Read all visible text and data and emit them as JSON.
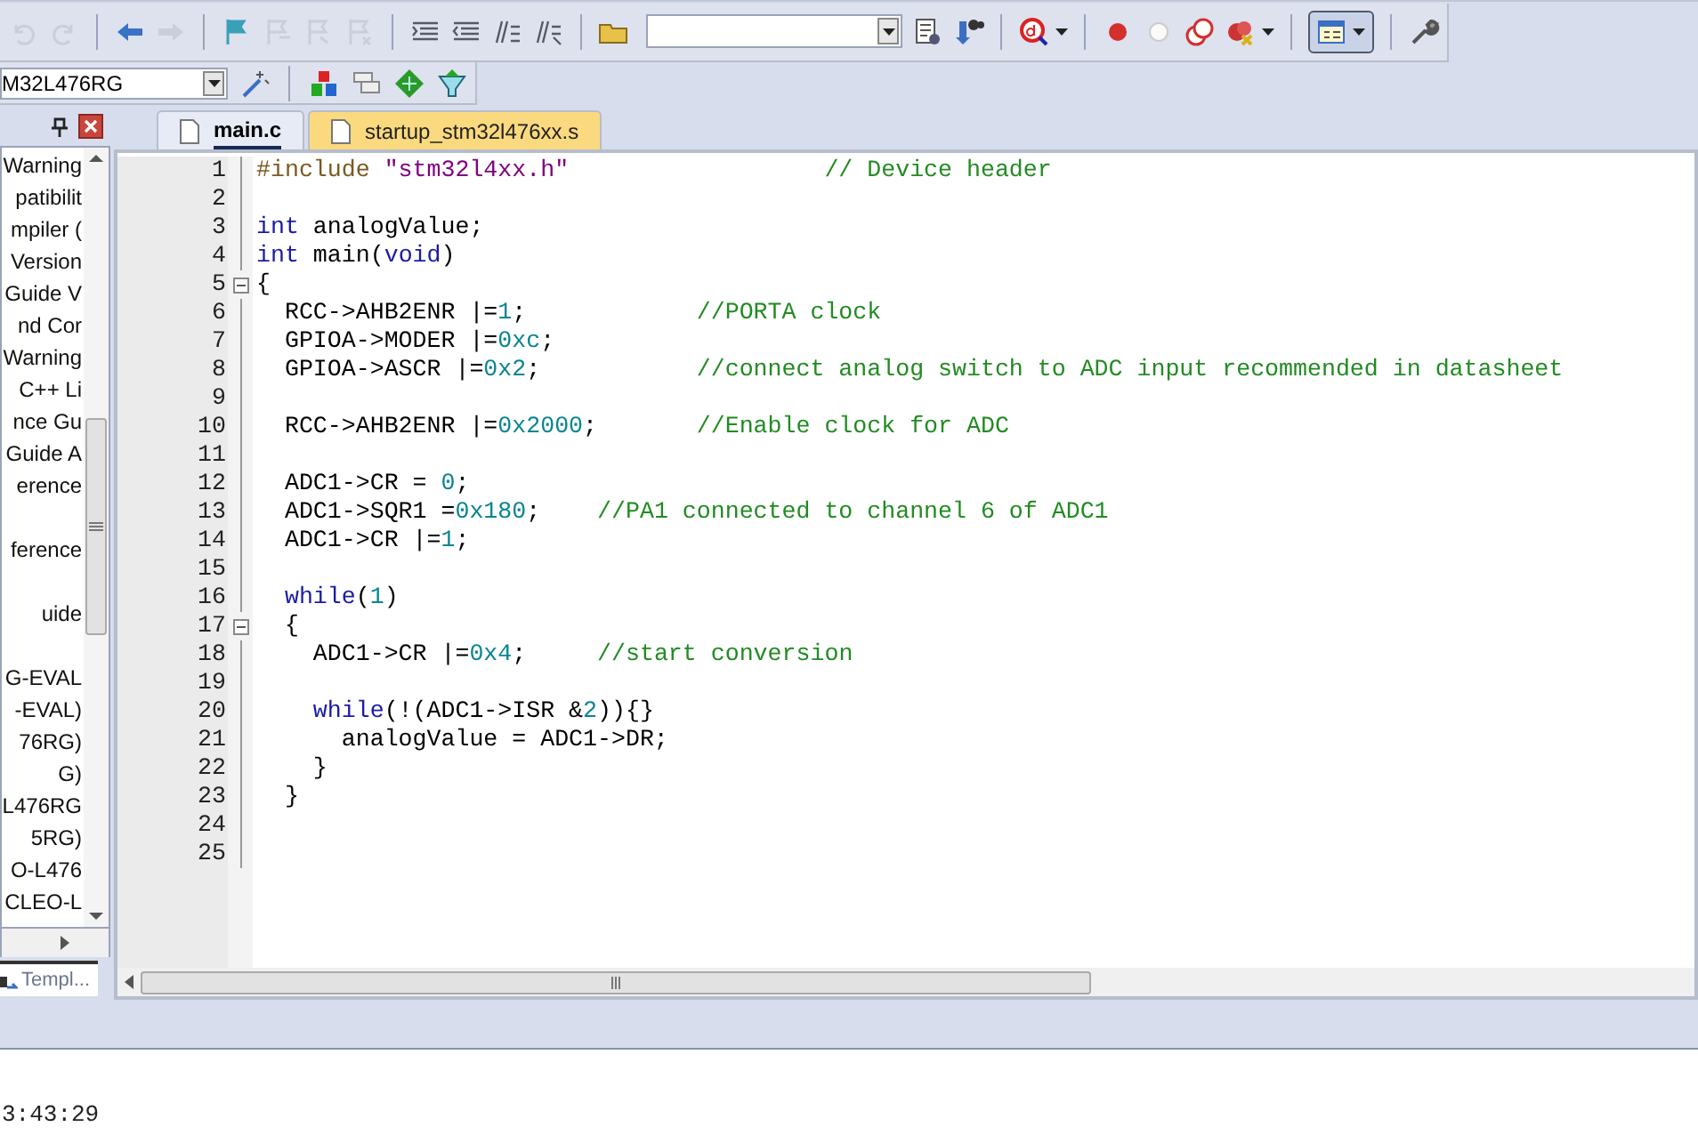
{
  "toolbar": {
    "buttons": [
      {
        "disabled": true
      },
      {
        "disabled": true
      },
      {
        "disabled": false
      },
      {
        "disabled": true
      },
      {
        "disabled": false
      },
      {
        "disabled": true
      },
      {
        "disabled": true
      },
      {
        "disabled": true
      },
      {
        "disabled": false
      },
      {
        "disabled": false
      },
      {
        "disabled": false
      },
      {
        "disabled": false
      },
      {
        "disabled": false
      }
    ],
    "tools": [
      {
        "disabled": false
      },
      {
        "disabled": false
      },
      {
        "disabled": false
      },
      {
        "disabled": false
      },
      {
        "disabled": false
      },
      {
        "disabled": false
      },
      {
        "disabled": false
      }
    ],
    "layout_button": {
      "pressed": true
    }
  },
  "target_bar": {
    "target": "M32L476RG",
    "buttons": [
      {
        "disabled": false
      },
      {
        "disabled": false
      },
      {
        "disabled": false
      },
      {
        "disabled": false
      },
      {
        "disabled": false
      }
    ]
  },
  "sidebar": {
    "items": [
      {
        "kind": "entry",
        "label": "Warning"
      },
      {
        "kind": "entry",
        "label": "patibilit"
      },
      {
        "kind": "entry",
        "label": "mpiler ("
      },
      {
        "kind": "entry",
        "label": "Version"
      },
      {
        "kind": "entry",
        "label": "Guide V"
      },
      {
        "kind": "entry",
        "label": "nd Cor"
      },
      {
        "kind": "entry",
        "label": "Warning"
      },
      {
        "kind": "entry",
        "label": "C++ Li"
      },
      {
        "kind": "entry",
        "label": "nce Gu"
      },
      {
        "kind": "entry",
        "label": "Guide A"
      },
      {
        "kind": "entry",
        "label": "erence"
      },
      {
        "kind": "blank"
      },
      {
        "kind": "entry",
        "label": "ference"
      },
      {
        "kind": "blank"
      },
      {
        "kind": "entry",
        "label": "uide"
      },
      {
        "kind": "blank"
      },
      {
        "kind": "entry",
        "label": "G-EVAL"
      },
      {
        "kind": "entry",
        "label": "-EVAL)"
      },
      {
        "kind": "entry",
        "label": "76RG)"
      },
      {
        "kind": "entry",
        "label": "G)"
      },
      {
        "kind": "entry",
        "label": "L476RG"
      },
      {
        "kind": "entry",
        "label": "5RG)"
      },
      {
        "kind": "entry",
        "label": "O-L476"
      },
      {
        "kind": "entry",
        "label": "CLEO-L"
      }
    ],
    "bottom_tab": {
      "label": "Templ..."
    }
  },
  "editor": {
    "tabs": [
      {
        "label": "main.c",
        "selected": true
      },
      {
        "label": "startup_stm32l476xx.s",
        "selected": false
      }
    ],
    "lines": [
      {
        "number": "1",
        "fold": false,
        "tokens": [
          {
            "kind": "preproc",
            "text": "#include "
          },
          {
            "kind": "string",
            "text": "\"stm32l4xx.h\""
          },
          {
            "kind": "comment",
            "text": "                  // Device header"
          }
        ]
      },
      {
        "number": "2",
        "fold": false
      },
      {
        "number": "3",
        "fold": false,
        "tokens": [
          {
            "kind": "keyword",
            "text": "int"
          },
          {
            "kind": "plain",
            "text": " analogValue;"
          }
        ]
      },
      {
        "number": "4",
        "fold": false,
        "tokens": [
          {
            "kind": "keyword",
            "text": "int"
          },
          {
            "kind": "plain",
            "text": " main("
          },
          {
            "kind": "keyword",
            "text": "void"
          },
          {
            "kind": "plain",
            "text": ")"
          }
        ]
      },
      {
        "number": "5",
        "fold": true,
        "tokens": [
          {
            "kind": "plain",
            "text": "{"
          }
        ]
      },
      {
        "number": "6",
        "fold": false,
        "tokens": [
          {
            "kind": "plain",
            "text": "  RCC->AHB2ENR |="
          },
          {
            "kind": "number",
            "text": "1"
          },
          {
            "kind": "plain",
            "text": ";"
          },
          {
            "kind": "comment",
            "text": "            //PORTA clock"
          }
        ]
      },
      {
        "number": "7",
        "fold": false,
        "tokens": [
          {
            "kind": "plain",
            "text": "  GPIOA->MODER |="
          },
          {
            "kind": "number",
            "text": "0xc"
          },
          {
            "kind": "plain",
            "text": ";"
          }
        ]
      },
      {
        "number": "8",
        "fold": false,
        "tokens": [
          {
            "kind": "plain",
            "text": "  GPIOA->ASCR |="
          },
          {
            "kind": "number",
            "text": "0x2"
          },
          {
            "kind": "plain",
            "text": ";"
          },
          {
            "kind": "comment",
            "text": "           //connect analog switch to ADC input recommended in datasheet"
          }
        ]
      },
      {
        "number": "9",
        "fold": false
      },
      {
        "number": "10",
        "fold": false,
        "tokens": [
          {
            "kind": "plain",
            "text": "  RCC->AHB2ENR |="
          },
          {
            "kind": "number",
            "text": "0x2000"
          },
          {
            "kind": "plain",
            "text": ";"
          },
          {
            "kind": "comment",
            "text": "       //Enable clock for ADC"
          }
        ]
      },
      {
        "number": "11",
        "fold": false
      },
      {
        "number": "12",
        "fold": false,
        "tokens": [
          {
            "kind": "plain",
            "text": "  ADC1->CR = "
          },
          {
            "kind": "number",
            "text": "0"
          },
          {
            "kind": "plain",
            "text": ";"
          }
        ]
      },
      {
        "number": "13",
        "fold": false,
        "tokens": [
          {
            "kind": "plain",
            "text": "  ADC1->SQR1 ="
          },
          {
            "kind": "number",
            "text": "0x180"
          },
          {
            "kind": "plain",
            "text": ";"
          },
          {
            "kind": "comment",
            "text": "    //PA1 connected to channel 6 of ADC1"
          }
        ]
      },
      {
        "number": "14",
        "fold": false,
        "tokens": [
          {
            "kind": "plain",
            "text": "  ADC1->CR |="
          },
          {
            "kind": "number",
            "text": "1"
          },
          {
            "kind": "plain",
            "text": ";"
          }
        ]
      },
      {
        "number": "15",
        "fold": false
      },
      {
        "number": "16",
        "fold": false,
        "tokens": [
          {
            "kind": "keyword",
            "text": "  while"
          },
          {
            "kind": "plain",
            "text": "("
          },
          {
            "kind": "number",
            "text": "1"
          },
          {
            "kind": "plain",
            "text": ")"
          }
        ]
      },
      {
        "number": "17",
        "fold": true,
        "tokens": [
          {
            "kind": "plain",
            "text": "  {"
          }
        ]
      },
      {
        "number": "18",
        "fold": false,
        "tokens": [
          {
            "kind": "plain",
            "text": "    ADC1->CR |="
          },
          {
            "kind": "number",
            "text": "0x4"
          },
          {
            "kind": "plain",
            "text": ";"
          },
          {
            "kind": "comment",
            "text": "     //start conversion"
          }
        ]
      },
      {
        "number": "19",
        "fold": false
      },
      {
        "number": "20",
        "fold": false,
        "tokens": [
          {
            "kind": "keyword",
            "text": "    while"
          },
          {
            "kind": "plain",
            "text": "(!(ADC1->ISR &"
          },
          {
            "kind": "number",
            "text": "2"
          },
          {
            "kind": "plain",
            "text": ")){}"
          }
        ]
      },
      {
        "number": "21",
        "fold": false,
        "tokens": [
          {
            "kind": "plain",
            "text": "      analogValue = ADC1->DR;"
          }
        ]
      },
      {
        "number": "22",
        "fold": false,
        "tokens": [
          {
            "kind": "plain",
            "text": "    }"
          }
        ]
      },
      {
        "number": "23",
        "fold": false,
        "tokens": [
          {
            "kind": "plain",
            "text": "  }"
          }
        ]
      },
      {
        "number": "24",
        "fold": false
      },
      {
        "number": "25",
        "fold": false
      }
    ]
  },
  "output": {
    "lines": [
      "3:43:29"
    ]
  }
}
